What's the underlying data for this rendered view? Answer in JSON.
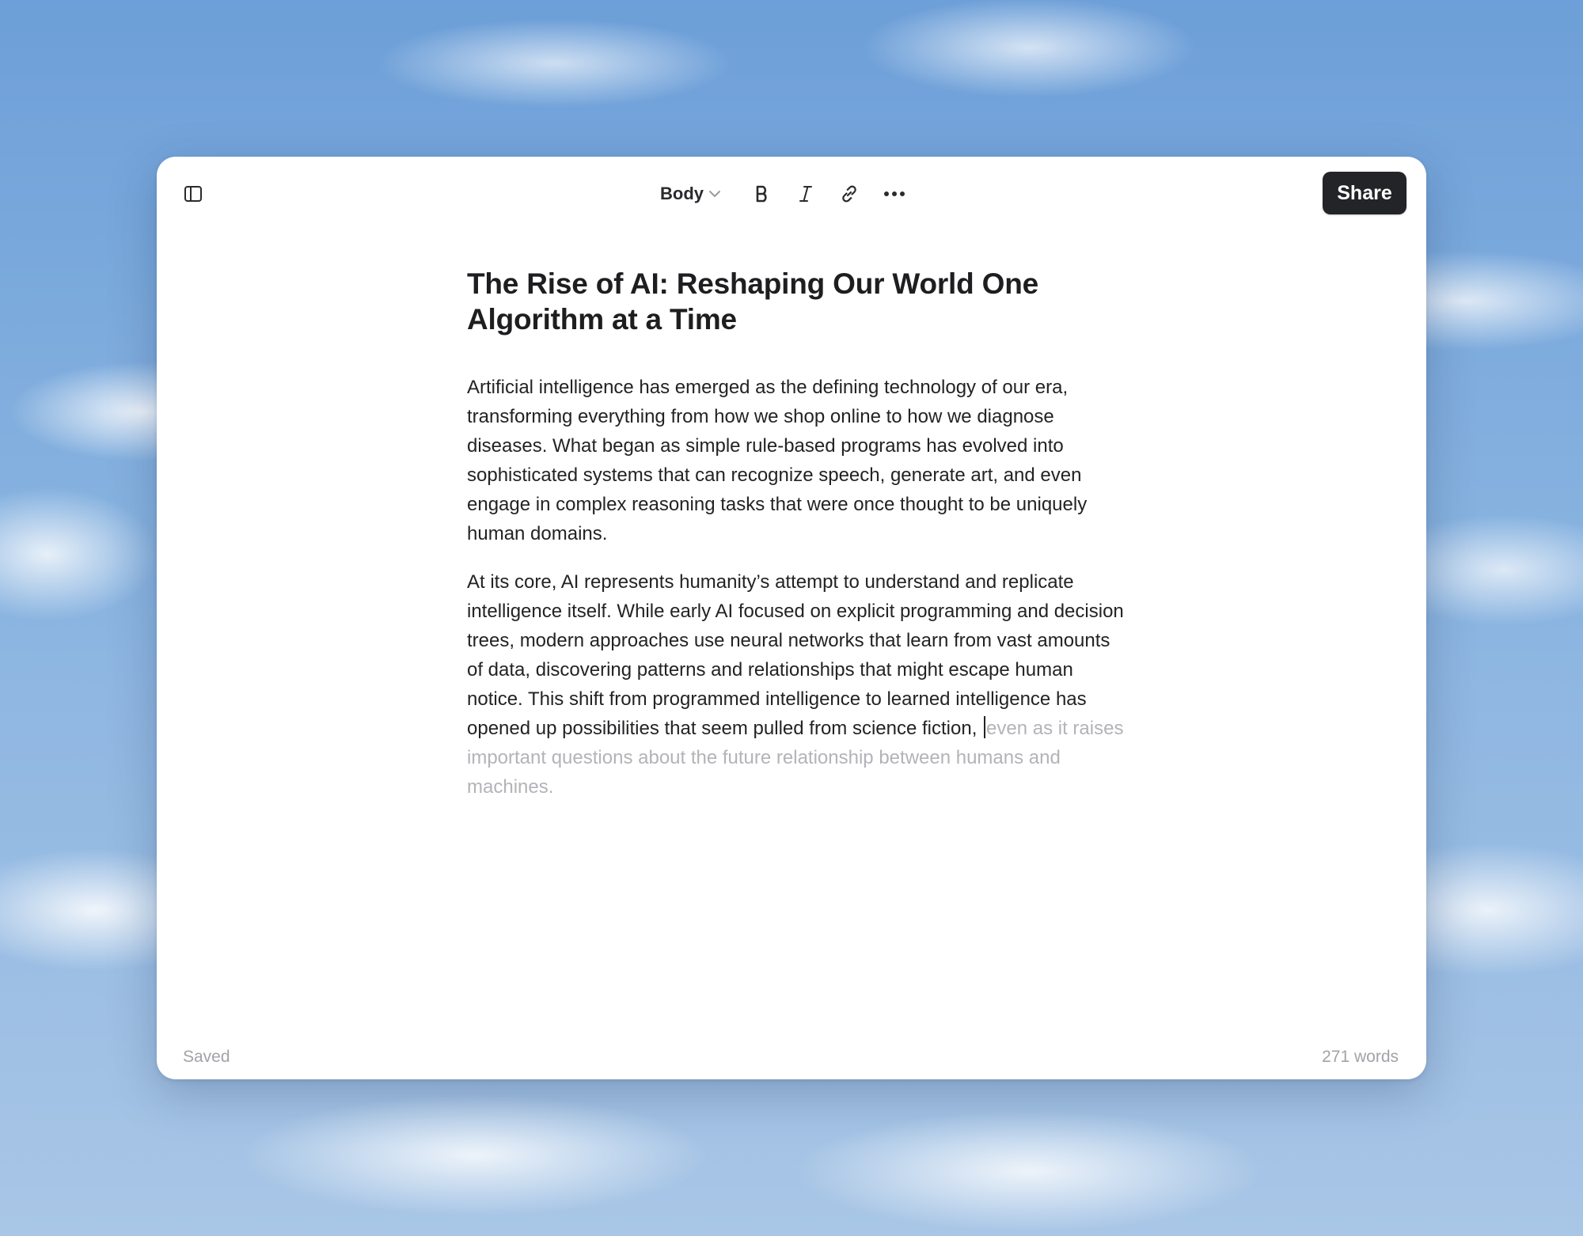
{
  "toolbar": {
    "sidebar_toggle_icon": "sidebar-toggle-icon",
    "style_select_value": "Body",
    "bold_icon": "bold-icon",
    "italic_icon": "italic-icon",
    "link_icon": "link-icon",
    "more_icon": "more-horizontal-icon",
    "share_label": "Share"
  },
  "document": {
    "title": "The Rise of AI: Reshaping Our World One Algorithm at a Time",
    "paragraphs": [
      "Artificial intelligence has emerged as the defining technology of our era, transforming everything from how we shop online to how we diagnose diseases. What began as simple rule-based programs has evolved into sophisticated systems that can recognize speech, generate art, and even engage in complex reasoning tasks that were once thought to be uniquely human domains.",
      "At its core, AI represents humanity’s attempt to understand and replicate intelligence itself. While early AI focused on explicit programming and decision trees, modern approaches use neural networks that learn from vast amounts of data, discovering patterns and relationships that might escape human notice. This shift from programmed intelligence to learned intelligence has opened up possibilities that seem pulled from science fiction, "
    ],
    "suggestion": "even as it raises important questions about the future relationship between humans and machines."
  },
  "footer": {
    "status": "Saved",
    "word_count": "271 words"
  },
  "colors": {
    "share_bg": "#232427",
    "text": "#232326",
    "suggestion_text": "#b3b3b8",
    "muted": "#a2a2a8"
  }
}
